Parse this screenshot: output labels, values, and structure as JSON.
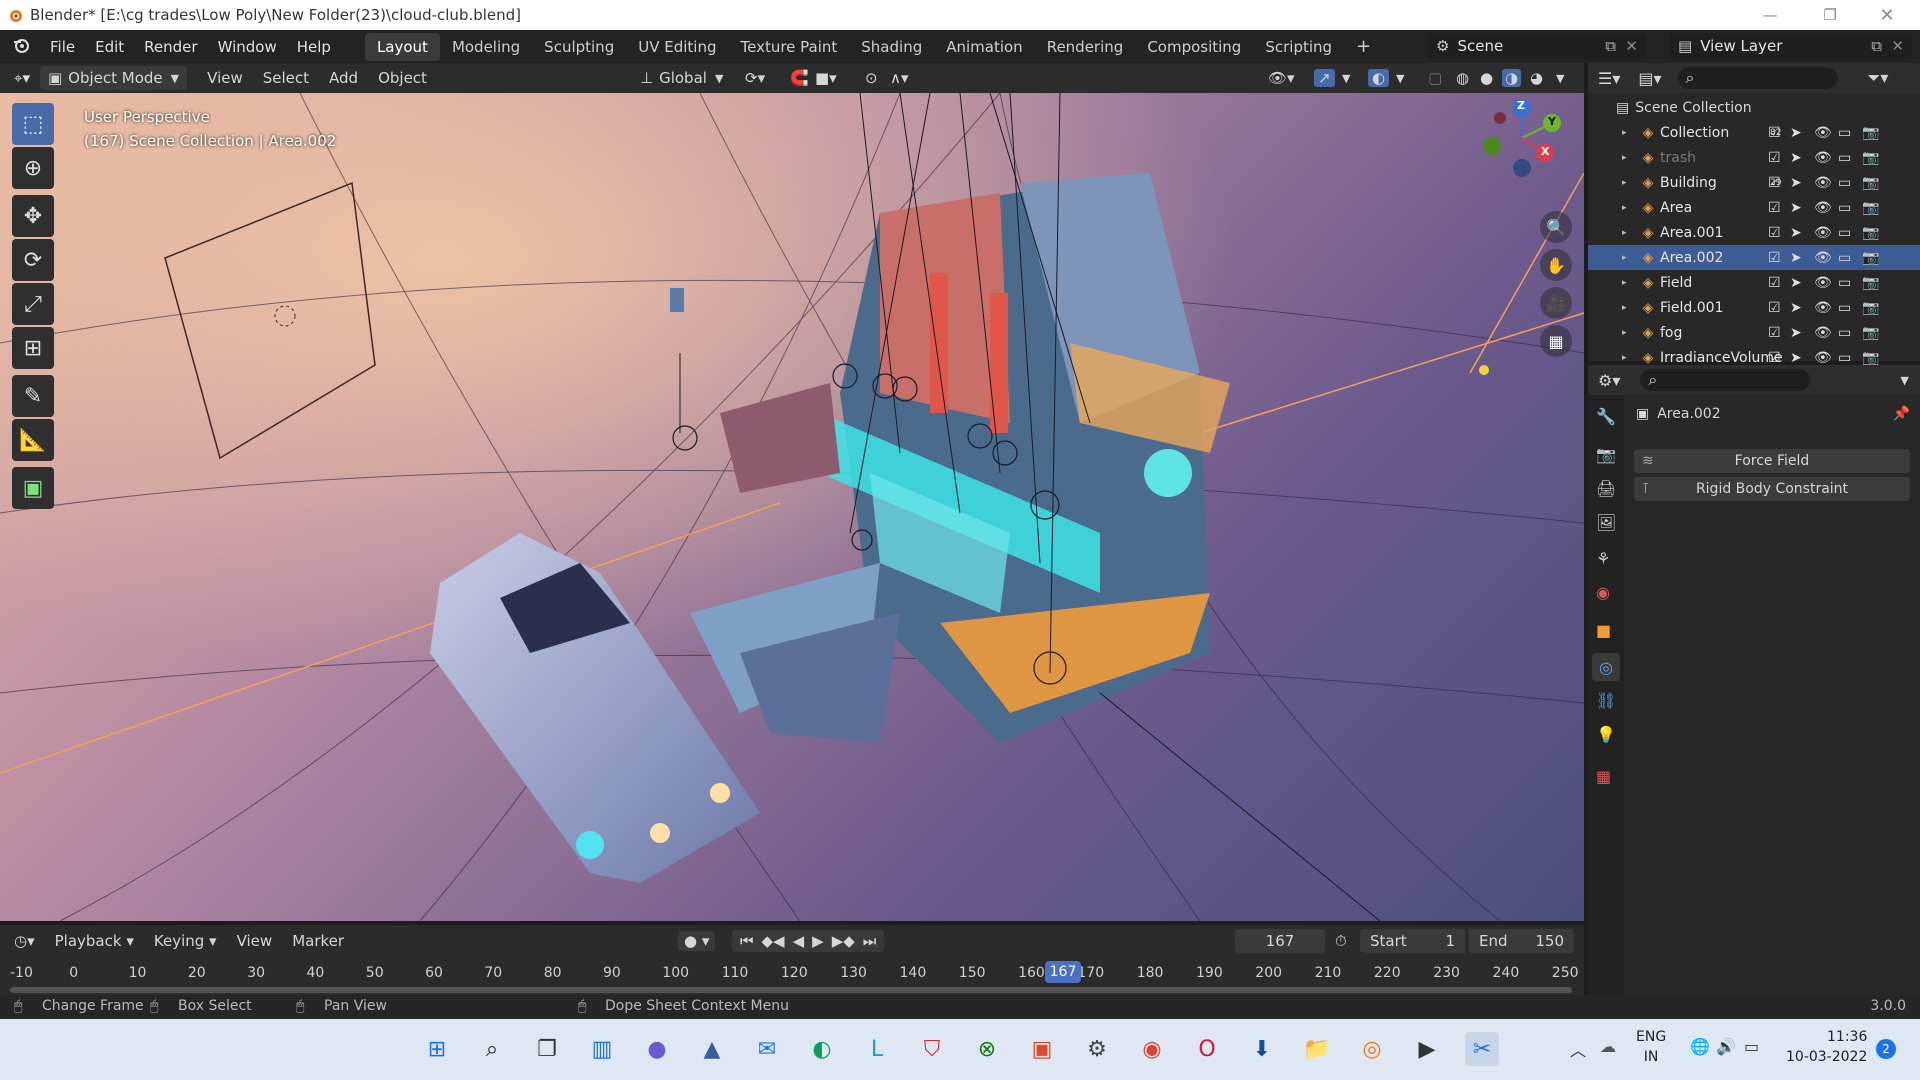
{
  "window": {
    "title": "Blender* [E:\\cg trades\\Low Poly\\New Folder(23)\\cloud-club.blend]"
  },
  "menu": {
    "items": [
      "File",
      "Edit",
      "Render",
      "Window",
      "Help"
    ]
  },
  "workspaces": [
    "Layout",
    "Modeling",
    "Sculpting",
    "UV Editing",
    "Texture Paint",
    "Shading",
    "Animation",
    "Rendering",
    "Compositing",
    "Scripting"
  ],
  "active_workspace": "Layout",
  "scene_label": "Scene",
  "view_layer_label": "View Layer",
  "viewport_header": {
    "mode": "Object Mode",
    "menus": [
      "View",
      "Select",
      "Add",
      "Object"
    ],
    "orientation": "Global"
  },
  "viewport_overlay": {
    "line1": "User Perspective",
    "line2": "(167) Scene Collection | Area.002"
  },
  "gizmo": {
    "z": "Z",
    "y": "Y",
    "x": "X"
  },
  "outliner": {
    "root": "Scene Collection",
    "rows": [
      {
        "name": "Collection",
        "badge": "82",
        "selected": false,
        "dim": false
      },
      {
        "name": "trash",
        "badge": "",
        "selected": false,
        "dim": true
      },
      {
        "name": "Building",
        "badge": "29",
        "selected": false,
        "dim": false
      },
      {
        "name": "Area",
        "badge": "",
        "selected": false,
        "dim": false
      },
      {
        "name": "Area.001",
        "badge": "",
        "selected": false,
        "dim": false
      },
      {
        "name": "Area.002",
        "badge": "",
        "selected": true,
        "dim": false
      },
      {
        "name": "Field",
        "badge": "",
        "selected": false,
        "dim": false
      },
      {
        "name": "Field.001",
        "badge": "",
        "selected": false,
        "dim": false
      },
      {
        "name": "fog",
        "badge": "",
        "selected": false,
        "dim": false
      },
      {
        "name": "IrradianceVolume",
        "badge": "",
        "selected": false,
        "dim": false
      }
    ]
  },
  "properties": {
    "object_name": "Area.002",
    "buttons": [
      "Force Field",
      "Rigid Body Constraint"
    ]
  },
  "timeline": {
    "menus": [
      "Playback",
      "Keying",
      "View",
      "Marker"
    ],
    "current_frame": "167",
    "start_label": "Start",
    "start": "1",
    "end_label": "End",
    "end": "150",
    "ruler": [
      "-10",
      "0",
      "10",
      "20",
      "30",
      "40",
      "50",
      "60",
      "70",
      "80",
      "90",
      "100",
      "110",
      "120",
      "130",
      "140",
      "150",
      "160",
      "170",
      "180",
      "190",
      "200",
      "210",
      "220",
      "230",
      "240",
      "250"
    ],
    "playhead": "167"
  },
  "status": {
    "change_frame": "Change Frame",
    "box_select": "Box Select",
    "pan_view": "Pan View",
    "context_menu": "Dope Sheet Context Menu",
    "version": "3.0.0"
  },
  "taskbar": {
    "lang1": "ENG",
    "lang2": "IN",
    "time": "11:36",
    "date": "10-03-2022",
    "notif": "2"
  }
}
